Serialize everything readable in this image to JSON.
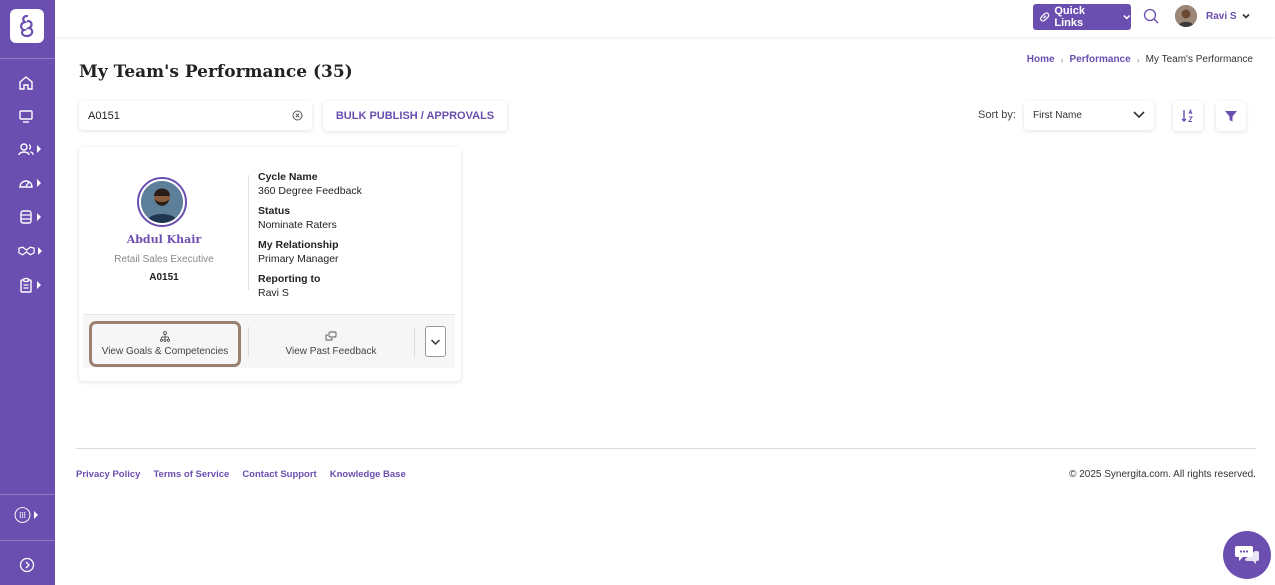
{
  "topbar": {
    "quick_links_label": "Quick Links",
    "user_name": "Ravi S"
  },
  "breadcrumb": {
    "home": "Home",
    "performance": "Performance",
    "current": "My Team's Performance"
  },
  "page": {
    "title": "My Team's Performance (35)"
  },
  "toolbar": {
    "search_value": "A0151",
    "bulk_label": "BULK PUBLISH / APPROVALS",
    "sort_label": "Sort by:",
    "sort_value": "First Name"
  },
  "card": {
    "name": "Abdul Khair",
    "role": "Retail Sales Executive",
    "emp_id": "A0151",
    "fields": [
      {
        "label": "Cycle Name",
        "value": "360 Degree Feedback"
      },
      {
        "label": "Status",
        "value": "Nominate Raters"
      },
      {
        "label": "My Relationship",
        "value": "Primary Manager"
      },
      {
        "label": "Reporting to",
        "value": "Ravi S"
      }
    ],
    "actions": {
      "goals": "View Goals & Competencies",
      "past_feedback": "View Past Feedback"
    }
  },
  "footer": {
    "links": [
      "Privacy Policy",
      "Terms of Service",
      "Contact Support",
      "Knowledge Base"
    ],
    "copyright": "© 2025 Synergita.com. All rights reserved."
  },
  "colors": {
    "brand": "#6a4fb0",
    "highlight_border": "#9a8070"
  }
}
